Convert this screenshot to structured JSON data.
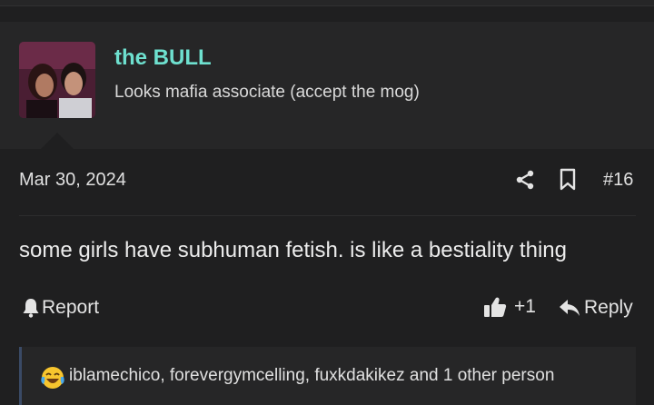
{
  "post": {
    "author": {
      "username": "the BULL",
      "user_title": "Looks mafia associate (accept the mog)"
    },
    "date": "Mar 30, 2024",
    "post_number": "#16",
    "message": "some girls have subhuman fetish. is like a bestiality thing",
    "actions": {
      "report_label": "Report",
      "like_count": "+1",
      "reply_label": "Reply"
    },
    "reactions": {
      "emoji": "crying-laughing",
      "text": "iblamechico, forevergymcelling, fuxkdakikez and 1 other person"
    }
  },
  "colors": {
    "background": "#1f1f20",
    "panel": "#262627",
    "username": "#6ee0cf",
    "text": "#e4e4e4"
  },
  "icons": [
    "share-icon",
    "bookmark-icon",
    "bell-icon",
    "thumbs-up-icon",
    "reply-icon",
    "crying-laughing-emoji-icon"
  ]
}
